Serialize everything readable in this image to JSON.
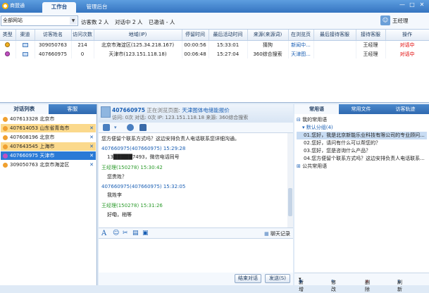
{
  "app": {
    "name": "商盟通"
  },
  "top_tabs": [
    {
      "label": "工作台"
    },
    {
      "label": "管理后台"
    }
  ],
  "window_controls": [
    "—",
    "□",
    "✕"
  ],
  "filter": {
    "site_select": "全部网站",
    "visitors_now": "访客数 2 人",
    "in_dialog": "对话中 2 人",
    "invited": "已邀请 - 人"
  },
  "current_user": "王经理",
  "visitor_table": {
    "headers": [
      "类型",
      "渠道",
      "访客姓名",
      "访问次数",
      "地域(IP)",
      "停留时间",
      "最后活动时间",
      "来源(来源词)",
      "在浏览页",
      "最后接待客服",
      "接待客服",
      "操作"
    ],
    "rows": [
      {
        "type": "yellow",
        "visitor": "309050763",
        "visits": "214",
        "region": "北京市海淀区(125.34.218.167)",
        "stay": "00:00:56",
        "last_active": "15:33:01",
        "source": "猜狗",
        "page": "新闻中...",
        "last_agent": "",
        "agent": "王经理",
        "action": "对话中"
      },
      {
        "type": "purple",
        "visitor": "407660975",
        "visits": "0",
        "region": "天津市(123.151.118.18)",
        "stay": "00:06:48",
        "last_active": "15:27:04",
        "source": "360综合搜索",
        "page": "天津图...",
        "last_agent": "",
        "agent": "王经理",
        "action": "对话中"
      }
    ]
  },
  "left_tabs": [
    {
      "label": "对话列表"
    },
    {
      "label": "客服"
    }
  ],
  "conversations": [
    {
      "id": "407613328",
      "city": "北京市",
      "state": "normal"
    },
    {
      "id": "407614053",
      "city": "山东省青岛市",
      "state": "highlight"
    },
    {
      "id": "407608196",
      "city": "北京市",
      "state": "normal"
    },
    {
      "id": "407643545",
      "city": "上海市",
      "state": "highlight"
    },
    {
      "id": "407660975",
      "city": "天津市",
      "state": "selected"
    },
    {
      "id": "309050763",
      "city": "北京市海淀区",
      "state": "normal"
    }
  ],
  "chat": {
    "visitor_id": "407660975",
    "browsing_label": "正在浏览页面:",
    "browsing_page": "天津图体电储能报价",
    "meta": "访问: 0次 对话: 0次 IP: 123.151.118.18 来源: 360综合搜索",
    "messages": [
      {
        "who": "",
        "head": "",
        "body": "您方便留个联系方式吗？这边安排负责人电话联系您详细沟通。"
      },
      {
        "who": "visitor",
        "head": "407660975(407660975) 15:29:28",
        "body": "13█████7493，微信电话同号"
      },
      {
        "who": "agent",
        "head": "王经理(150278) 15:30:42",
        "body": "您贵姓？"
      },
      {
        "who": "visitor",
        "head": "407660975(407660975) 15:32:05",
        "body": "我姓李"
      },
      {
        "who": "agent",
        "head": "王经理(150278) 15:31:26",
        "body": "好嘞，稍等"
      }
    ],
    "history_label": "聊天记录",
    "end_button": "结束对话",
    "send_button": "发送(S)"
  },
  "right_tabs": [
    {
      "label": "常用语"
    },
    {
      "label": "常用文件"
    },
    {
      "label": "访客轨迹"
    }
  ],
  "phrases": {
    "my_group": "我的常用语",
    "default_group": "默认分组(4)",
    "items": [
      "01.您好，我是北京新能乐业科技有限公司的专业顾问...",
      "02.您好，请问有什么可以帮您的？",
      "03.您好，您是咨询什么产品？",
      "04.您方便留个联系方式吗？这边安排负责人电话联系..."
    ],
    "public_group": "公共常用语"
  },
  "right_actions": [
    {
      "label": "新增"
    },
    {
      "label": "修改"
    },
    {
      "label": "删除"
    },
    {
      "label": "刷新"
    }
  ]
}
